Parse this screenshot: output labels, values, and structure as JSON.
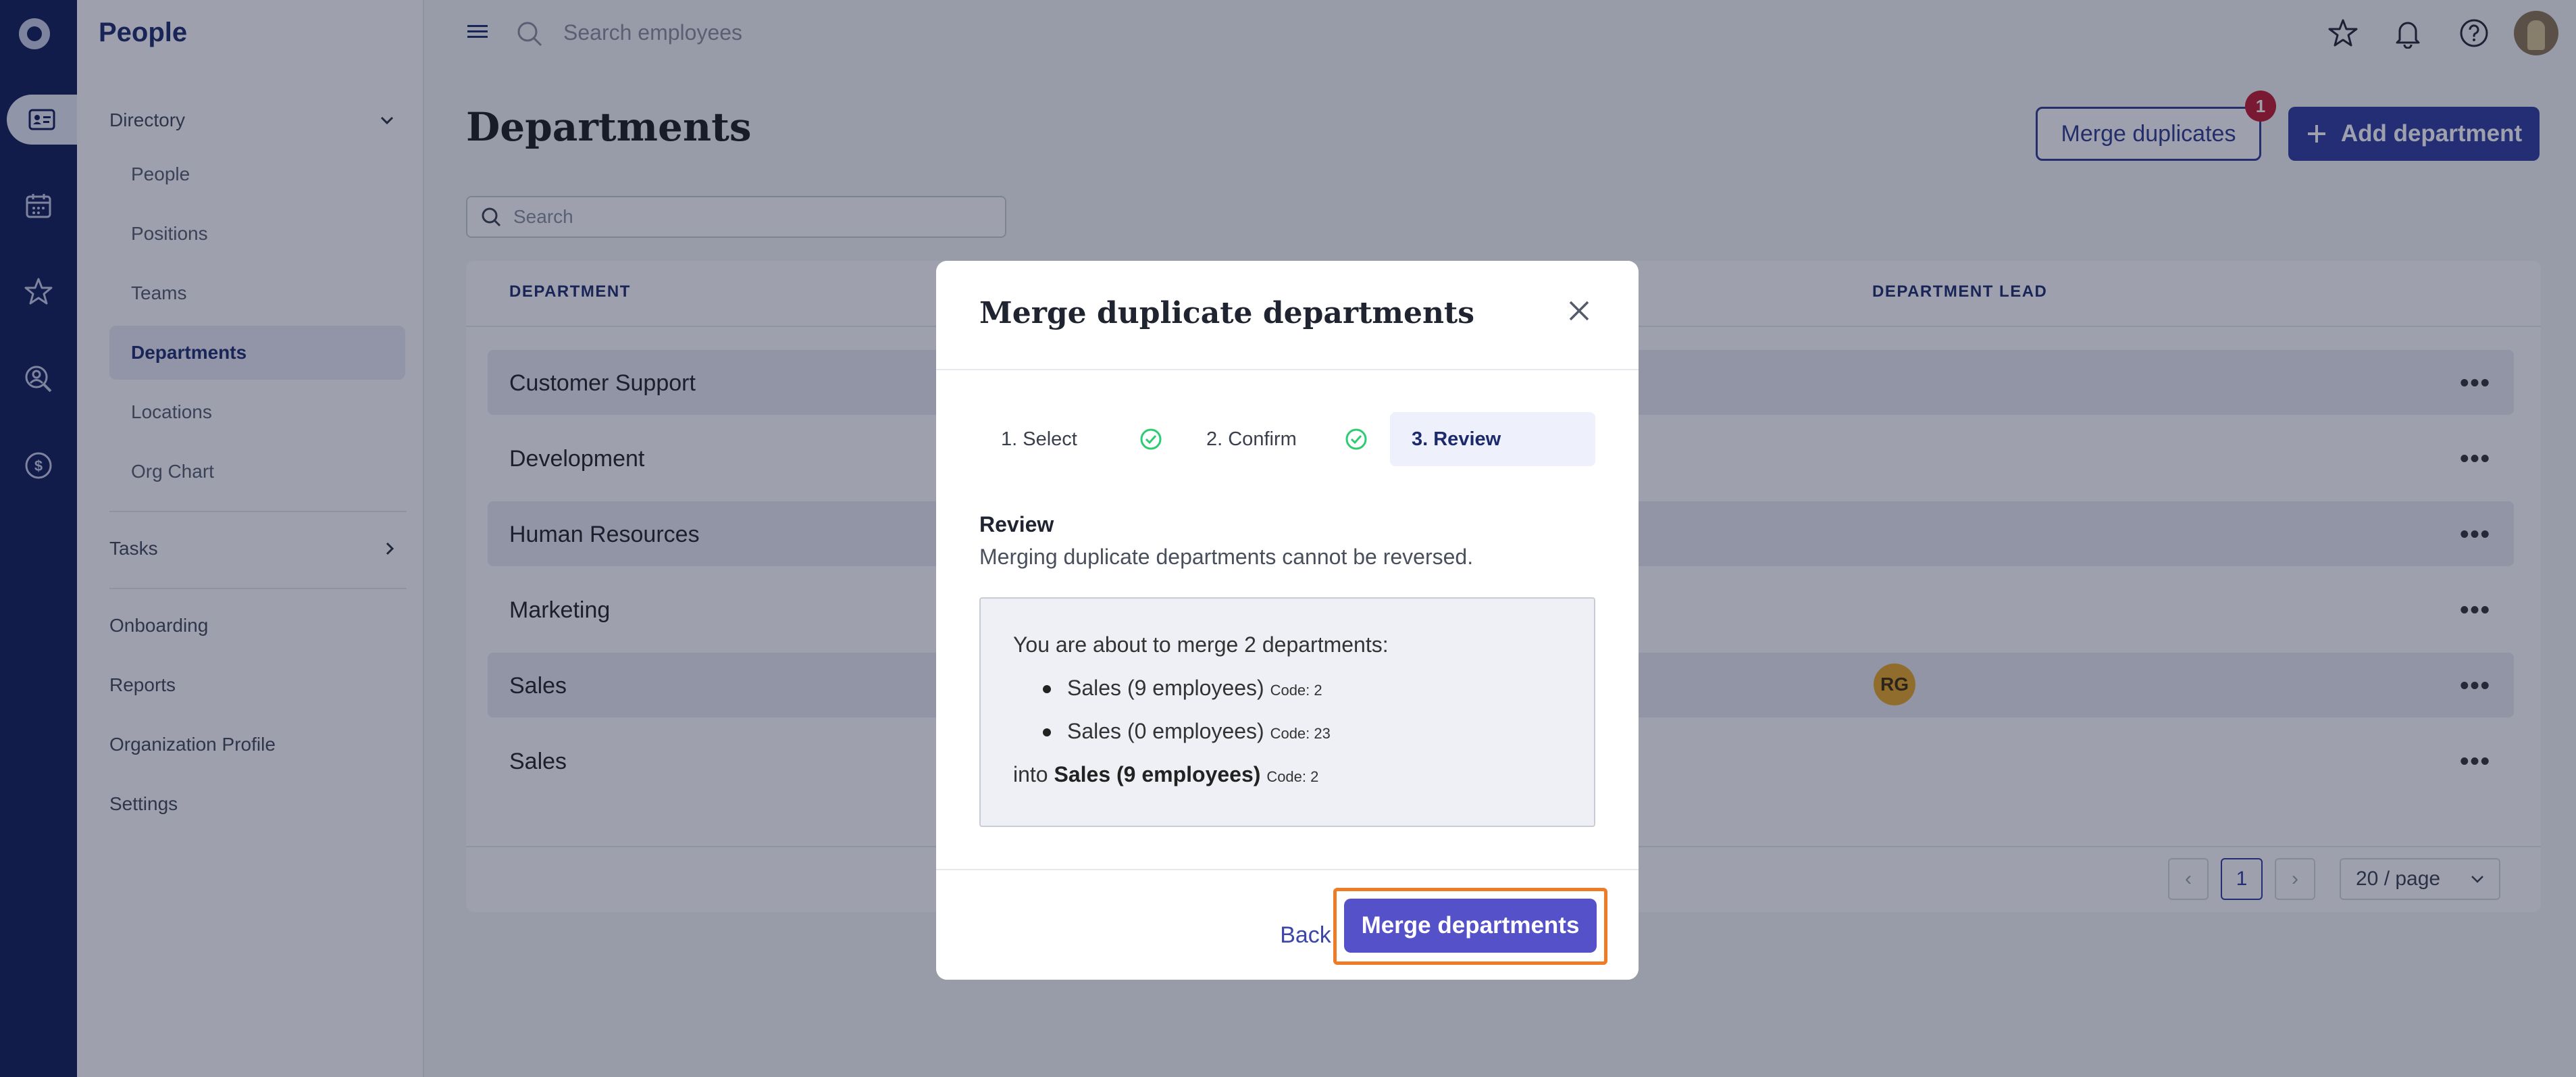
{
  "app": {
    "section_title": "People"
  },
  "rail": {
    "icons": [
      "app-logo",
      "people-card-icon",
      "calendar-icon",
      "star-icon",
      "search-person-icon",
      "dollar-icon"
    ]
  },
  "nav": {
    "directory_label": "Directory",
    "directory_items": [
      "People",
      "Positions",
      "Teams",
      "Departments",
      "Locations",
      "Org Chart"
    ],
    "tasks_label": "Tasks",
    "bottom_items": [
      "Onboarding",
      "Reports",
      "Organization Profile",
      "Settings"
    ]
  },
  "topbar": {
    "search_placeholder": "Search employees"
  },
  "page": {
    "title": "Departments",
    "merge_duplicates_label": "Merge duplicates",
    "merge_badge_count": "1",
    "add_department_label": "Add department",
    "search_placeholder": "Search"
  },
  "table": {
    "columns": [
      "DEPARTMENT",
      "DEPARTMENT LEAD"
    ],
    "rows": [
      {
        "name": "Customer Support",
        "lead": ""
      },
      {
        "name": "Development",
        "lead": ""
      },
      {
        "name": "Human Resources",
        "lead": ""
      },
      {
        "name": "Marketing",
        "lead": ""
      },
      {
        "name": "Sales",
        "lead": "RG"
      },
      {
        "name": "Sales",
        "lead": ""
      }
    ],
    "pagination": {
      "current_page": "1",
      "page_size": "20 / page"
    }
  },
  "modal": {
    "title": "Merge duplicate departments",
    "steps": [
      "1. Select",
      "2. Confirm",
      "3. Review"
    ],
    "review_heading": "Review",
    "review_text": "Merging duplicate departments cannot be reversed.",
    "summary_intro": "You are about to merge 2 departments:",
    "items": [
      {
        "label": "Sales (9 employees)",
        "code": "Code: 2"
      },
      {
        "label": "Sales (0 employees)",
        "code": "Code: 23"
      }
    ],
    "into_prefix": "into",
    "into_target": "Sales (9 employees)",
    "into_code": "Code: 2",
    "back_label": "Back",
    "merge_label": "Merge departments"
  },
  "colors": {
    "rail": "#0e1a57",
    "primary": "#2e3a9e",
    "modal_primary": "#5551c8",
    "highlight": "#ef7b27",
    "badge": "#c0172c",
    "check": "#2ecc71"
  }
}
